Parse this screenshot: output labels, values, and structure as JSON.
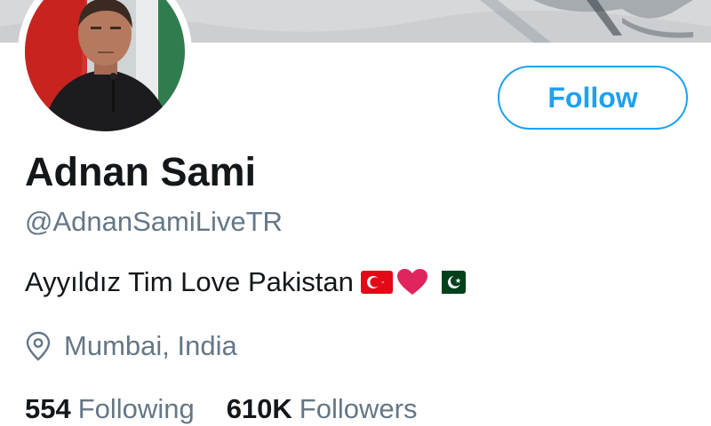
{
  "profile": {
    "display_name": "Adnan Sami",
    "handle": "@AdnanSamiLiveTR",
    "bio_text": "Ayyıldız Tim Love Pakistan",
    "bio_emojis": [
      "turkey-flag",
      "red-heart",
      "pakistan-flag"
    ],
    "location": "Mumbai, India"
  },
  "actions": {
    "follow_label": "Follow"
  },
  "stats": {
    "following_count": "554",
    "following_label": "Following",
    "followers_count": "610K",
    "followers_label": "Followers"
  },
  "colors": {
    "accent": "#1da1f2",
    "text_primary": "#14171a",
    "text_secondary": "#657786",
    "heart": "#e0245e",
    "turkey_red": "#e30a17",
    "pakistan_green": "#01411c"
  },
  "icons": {
    "location": "location-pin-icon"
  }
}
